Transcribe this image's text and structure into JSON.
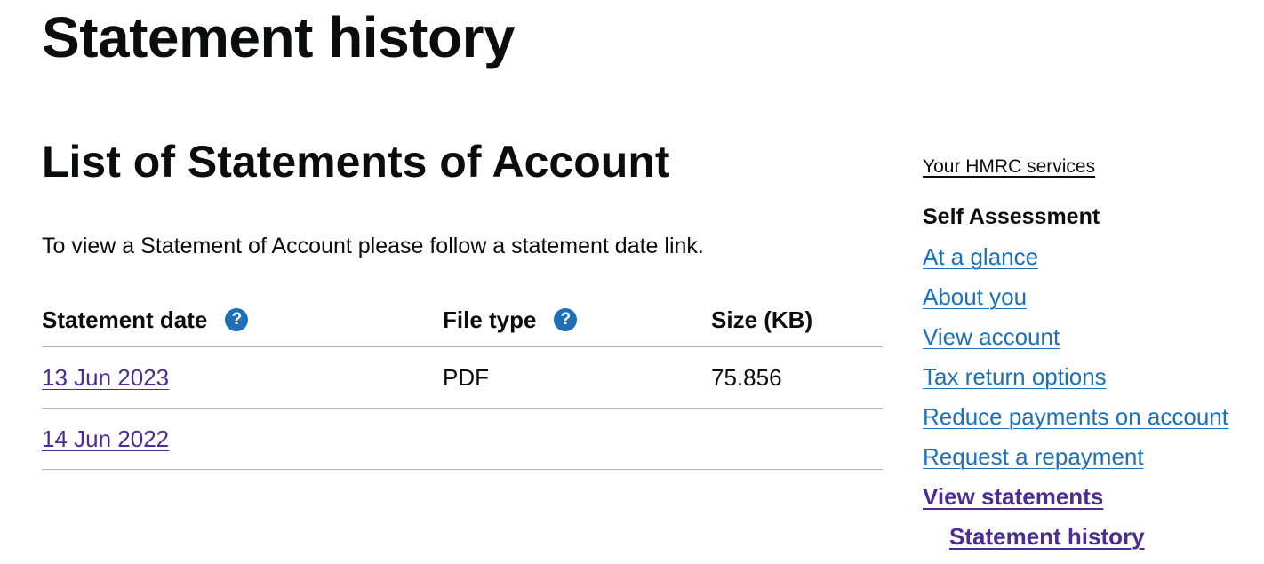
{
  "page": {
    "title": "Statement history",
    "section_title": "List of Statements of Account",
    "intro": "To view a Statement of Account please follow a statement date link."
  },
  "table": {
    "headers": {
      "date": "Statement date",
      "type": "File type",
      "size": "Size (KB)"
    },
    "help_icon_glyph": "?",
    "rows": [
      {
        "date": "13 Jun 2023",
        "type": "PDF",
        "size": "75.856"
      },
      {
        "date": "14 Jun 2022",
        "type": "",
        "size": ""
      }
    ]
  },
  "sidebar": {
    "services_link": "Your HMRC services",
    "heading": "Self Assessment",
    "links": [
      "At a glance",
      "About you",
      "View account",
      "Tax return options",
      "Reduce payments on account",
      "Request a repayment"
    ],
    "active": "View statements",
    "active_sub": "Statement history"
  },
  "colors": {
    "text": "#0b0c0c",
    "link": "#1d70b8",
    "visited_link": "#4c2c92",
    "border": "#b1b4b6"
  }
}
